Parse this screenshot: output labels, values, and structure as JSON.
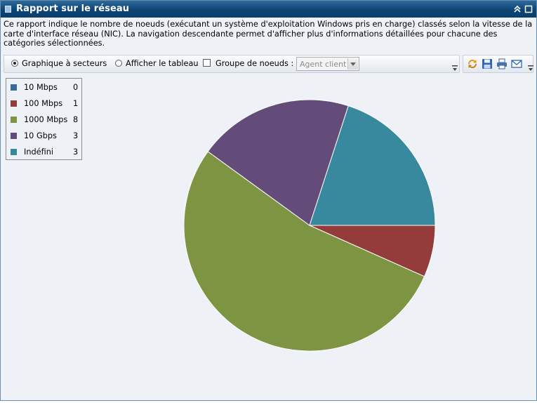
{
  "window": {
    "title": "Rapport sur le réseau",
    "collapse_glyph": "⌃",
    "maximize_glyph": "□"
  },
  "description": "Ce rapport indique le nombre de noeuds (exécutant un système d'exploitation Windows pris en charge) classés selon la vitesse de la carte d'interface réseau (NIC). La navigation descendante permet d'afficher plus d'informations détaillées pour chacune des catégories sélectionnées.",
  "toolbar": {
    "pie_option_label": "Graphique à secteurs",
    "pie_option_selected": true,
    "table_option_label": "Afficher le tableau",
    "table_option_selected": false,
    "group_checkbox_label": "Groupe de noeuds :",
    "group_checkbox_checked": false,
    "group_select_value": "Agent client",
    "icons": [
      "refresh-icon",
      "save-icon",
      "print-icon",
      "email-icon"
    ]
  },
  "chart_data": {
    "type": "pie",
    "categories": [
      "10 Mbps",
      "100 Mbps",
      "1000 Mbps",
      "10 Gbps",
      "Indéfini"
    ],
    "values": [
      0,
      1,
      8,
      3,
      3
    ],
    "colors": [
      "#3a6a9c",
      "#943b3b",
      "#7d9442",
      "#634c79",
      "#38889e"
    ],
    "start_angle_deg": 0,
    "legend_position": "top-left"
  }
}
